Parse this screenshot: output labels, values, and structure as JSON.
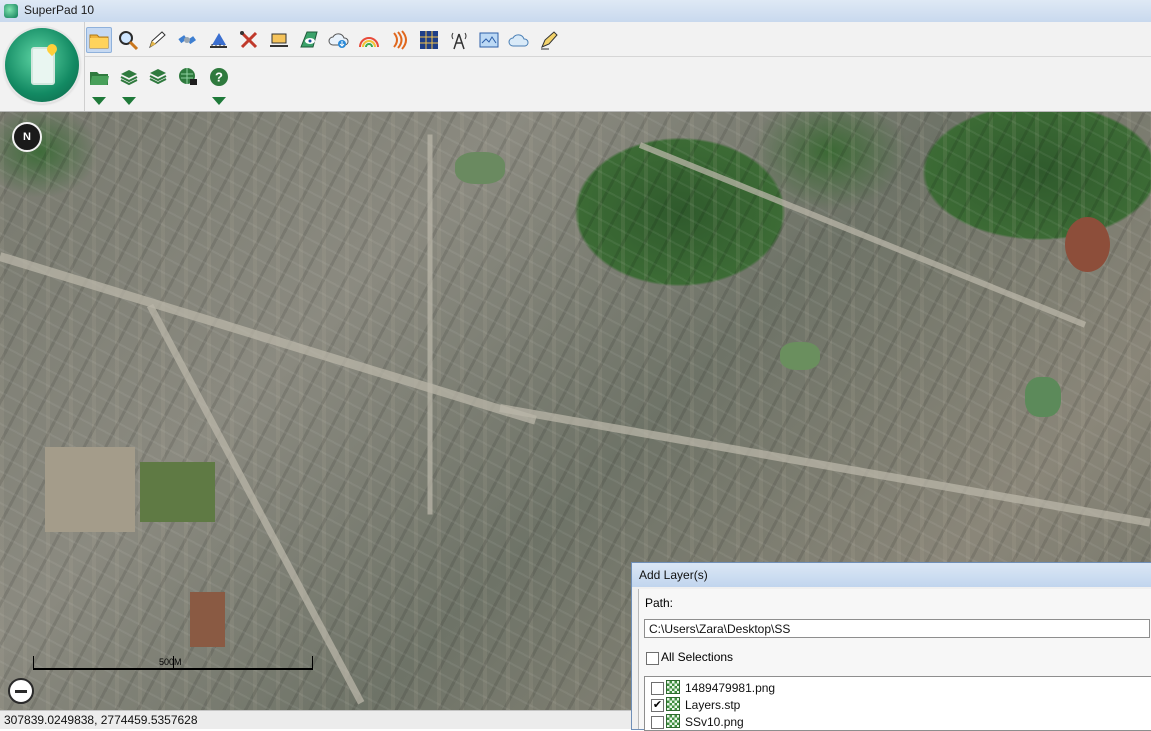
{
  "window": {
    "title": "SuperPad 10"
  },
  "toolbar": {
    "row1_icons": [
      "open-folder-icon",
      "magnifier-icon",
      "pencil-icon",
      "satellite-icon",
      "measure-ruler-icon",
      "tools-cross-icon",
      "laptop-icon",
      "map-eye-icon",
      "cloud-download-icon",
      "rainbow-map-icon",
      "signal-waves-icon",
      "grid-icon",
      "antenna-tower-icon",
      "map-window-icon",
      "cloud-icon",
      "pen-edit-icon"
    ],
    "row2_icons": [
      "folder-open-icon",
      "layers-add-icon",
      "layers-icon",
      "globe-lock-icon",
      "help-icon"
    ]
  },
  "map": {
    "compass_label": "N",
    "scale_label": "500M"
  },
  "status": {
    "coordinates": "307839.0249838, 2774459.5357628"
  },
  "add_layers": {
    "title": "Add Layer(s)",
    "path_label": "Path:",
    "path_value": "C:\\Users\\Zara\\Desktop\\SS",
    "all_selections_label": "All Selections",
    "files": [
      {
        "name": "1489479981.png",
        "checked": false
      },
      {
        "name": "Layers.stp",
        "checked": true
      },
      {
        "name": "SSv10.png",
        "checked": false
      }
    ]
  },
  "colors": {
    "accent_green": "#1f7a3a",
    "title_blue": "#c9d9ee"
  }
}
